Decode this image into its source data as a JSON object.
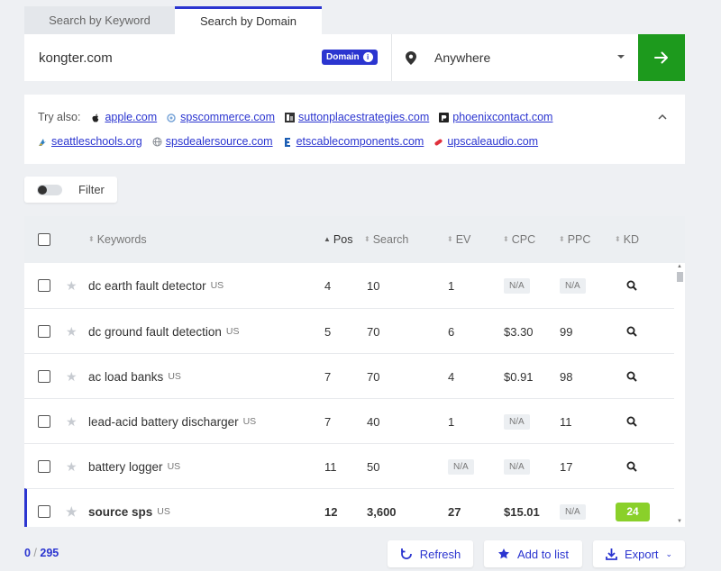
{
  "tabs": [
    {
      "label": "Search by Keyword",
      "active": false
    },
    {
      "label": "Search by Domain",
      "active": true
    }
  ],
  "search": {
    "value": "kongter.com",
    "badge": "Domain",
    "badge_info_icon": "info-icon",
    "location": "Anywhere",
    "go_icon": "arrow-right-icon"
  },
  "try_also": {
    "label": "Try also:",
    "links": [
      {
        "text": "apple.com",
        "icon": "apple-icon",
        "color": "#222222"
      },
      {
        "text": "spscommerce.com",
        "icon": "sps-logo-icon",
        "color": "#7aa6d8"
      },
      {
        "text": "suttonplacestrategies.com",
        "icon": "sutton-logo-icon",
        "color": "#333333"
      },
      {
        "text": "phoenixcontact.com",
        "icon": "phoenix-logo-icon",
        "color": "#222222"
      },
      {
        "text": "seattleschools.org",
        "icon": "seattle-logo-icon",
        "color": "#2f7fbf"
      },
      {
        "text": "spsdealersource.com",
        "icon": "globe-icon",
        "color": "#8a8f96"
      },
      {
        "text": "etscablecomponents.com",
        "icon": "ets-logo-icon",
        "color": "#1a5db3"
      },
      {
        "text": "upscaleaudio.com",
        "icon": "upscale-logo-icon",
        "color": "#e0303c"
      }
    ]
  },
  "filter": {
    "label": "Filter"
  },
  "table": {
    "headers": {
      "keywords": "Keywords",
      "pos": "Pos",
      "search": "Search",
      "ev": "EV",
      "cpc": "CPC",
      "ppc": "PPC",
      "kd": "KD"
    },
    "rows": [
      {
        "keyword": "dc earth fault detector",
        "country": "US",
        "pos": "4",
        "search": "10",
        "ev": "1",
        "cpc": "N/A",
        "ppc": "N/A",
        "kd": "search",
        "highlight": false
      },
      {
        "keyword": "dc ground fault detection",
        "country": "US",
        "pos": "5",
        "search": "70",
        "ev": "6",
        "cpc": "$3.30",
        "ppc": "99",
        "kd": "search",
        "highlight": false
      },
      {
        "keyword": "ac load banks",
        "country": "US",
        "pos": "7",
        "search": "70",
        "ev": "4",
        "cpc": "$0.91",
        "ppc": "98",
        "kd": "search",
        "highlight": false
      },
      {
        "keyword": "lead-acid battery discharger",
        "country": "US",
        "pos": "7",
        "search": "40",
        "ev": "1",
        "cpc": "N/A",
        "ppc": "11",
        "kd": "search",
        "highlight": false
      },
      {
        "keyword": "battery logger",
        "country": "US",
        "pos": "11",
        "search": "50",
        "ev": "N/A",
        "cpc": "N/A",
        "ppc": "17",
        "kd": "search",
        "highlight": false
      },
      {
        "keyword": "source sps",
        "country": "US",
        "pos": "12",
        "search": "3,600",
        "ev": "27",
        "cpc": "$15.01",
        "ppc": "N/A",
        "kd": "24",
        "highlight": true
      }
    ]
  },
  "footer": {
    "selected": "0",
    "separator": " / ",
    "total": "295",
    "refresh_label": "Refresh",
    "add_label": "Add to list",
    "export_label": "Export"
  },
  "colors": {
    "accent": "#2b35d0",
    "go_button": "#1d9a1d",
    "kd_badge": "#8ad02a"
  }
}
